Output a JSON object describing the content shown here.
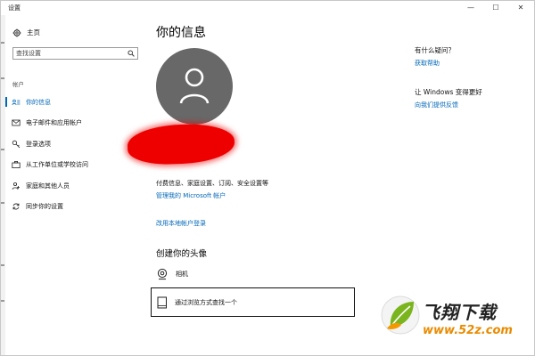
{
  "window": {
    "title": "设置",
    "min_glyph": "—",
    "max_glyph": "☐",
    "close_glyph": "✕"
  },
  "sidebar": {
    "home_label": "主页",
    "search_placeholder": "查找设置",
    "section_label": "帐户",
    "items": [
      {
        "label": "你的信息",
        "icon": "person-card-icon",
        "active": true
      },
      {
        "label": "电子邮件和应用帐户",
        "icon": "mail-icon",
        "active": false
      },
      {
        "label": "登录选项",
        "icon": "key-icon",
        "active": false
      },
      {
        "label": "从工作单位或学校访问",
        "icon": "briefcase-icon",
        "active": false
      },
      {
        "label": "家庭和其他人员",
        "icon": "people-icon",
        "active": false
      },
      {
        "label": "同步你的设置",
        "icon": "sync-icon",
        "active": false
      }
    ]
  },
  "main": {
    "title": "你的信息",
    "info_text": "付费信息、家庭设置、订阅、安全设置等",
    "manage_link": "管理我的 Microsoft 帐户",
    "local_link": "改用本地帐户登录",
    "create_title": "创建你的头像",
    "camera_label": "相机",
    "browse_label": "通过浏览方式查找一个"
  },
  "right": {
    "q_title": "有什么疑问？",
    "help_link": "获取帮助",
    "improve_title": "让 Windows 变得更好",
    "feedback_link": "向我们提供反馈"
  },
  "watermark": {
    "brand": "飞翔下载",
    "url": "www.52z.com"
  },
  "colors": {
    "accent": "#0067b8",
    "avatar_bg": "#686868",
    "redaction": "#ee0000"
  }
}
